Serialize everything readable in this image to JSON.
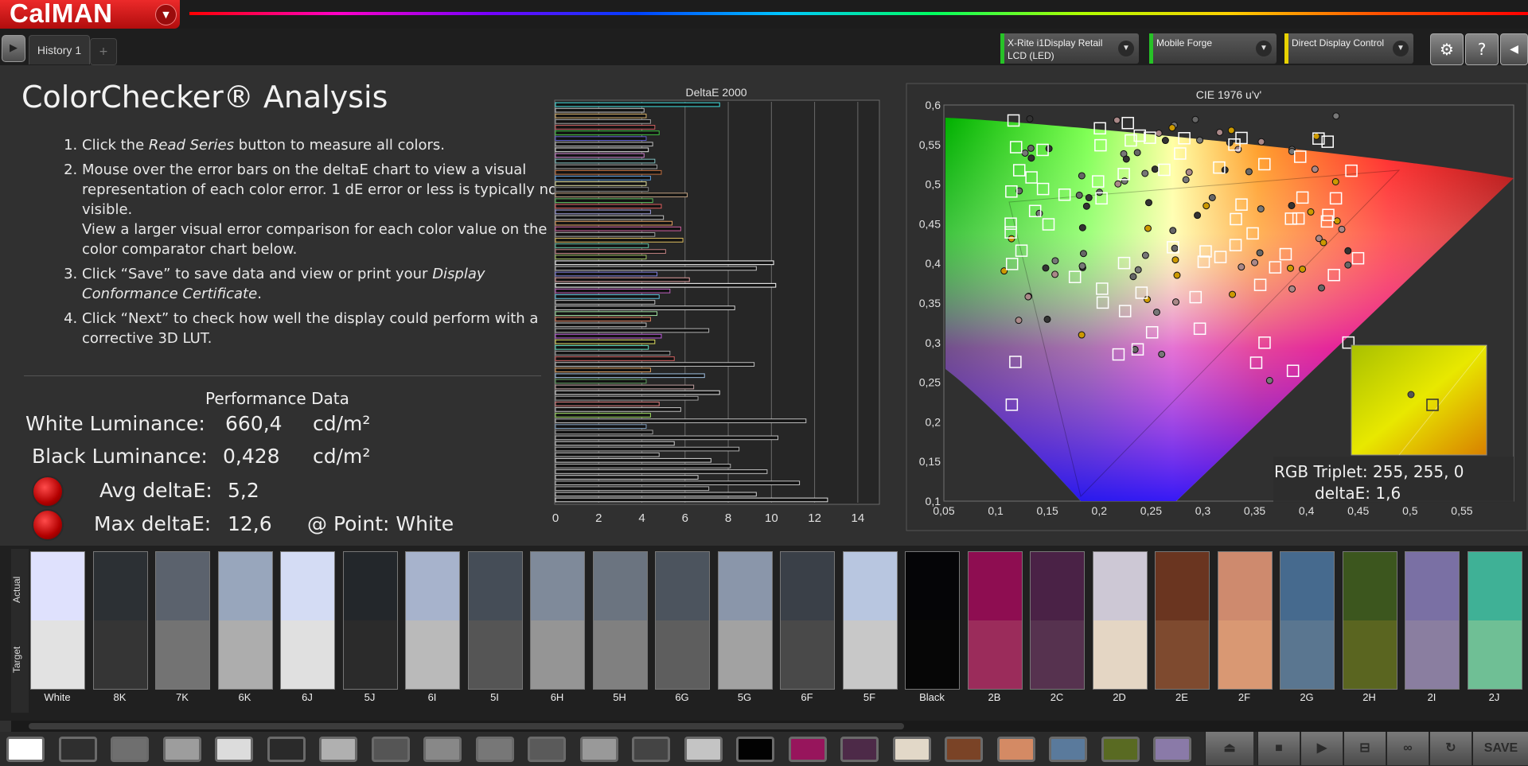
{
  "app": {
    "logo": "CalMAN",
    "menu_arrow": "▼"
  },
  "tabs": [
    {
      "label": "History 1"
    }
  ],
  "tab_add": "+",
  "devices": [
    {
      "line1": "X-Rite i1Display Retail",
      "line2": "LCD (LED)",
      "stripe": "#27c227"
    },
    {
      "line1": "Mobile Forge",
      "line2": "",
      "stripe": "#27c227"
    },
    {
      "line1": "Direct Display Control",
      "line2": "",
      "stripe": "#e8d200"
    }
  ],
  "toolbar_icons": [
    "gear-icon",
    "help-icon",
    "collapse-icon"
  ],
  "page": {
    "title": "ColorChecker® Analysis",
    "instructions": [
      {
        "before": "Click the ",
        "em": "Read Series",
        "after": " button to measure all colors."
      },
      {
        "before": "Mouse over the error bars on the deltaE chart to view a visual representation of each color error. 1 dE error or less is typically not visible.",
        "extra": "View a larger visual error comparison for each color value on the color comparator chart below."
      },
      {
        "before": "Click “Save” to save data and view or print your ",
        "em": "Display Conformance Certificate",
        "after": "."
      },
      {
        "before": "Click “Next” to check how well the display could perform with a corrective 3D LUT."
      }
    ]
  },
  "performance": {
    "title": "Performance Data",
    "white_label": "White Luminance:",
    "white_value": "660,4",
    "white_unit": "cd/m²",
    "black_label": "Black Luminance:",
    "black_value": "0,428",
    "black_unit": "cd/m²",
    "avg_label": "Avg deltaE:",
    "avg_value": "5,2",
    "max_label": "Max deltaE:",
    "max_value": "12,6",
    "point_label": "@ Point: White"
  },
  "cie": {
    "title": "CIE 1976 u'v'",
    "x_ticks": [
      "0,05",
      "0,1",
      "0,15",
      "0,2",
      "0,25",
      "0,3",
      "0,35",
      "0,4",
      "0,45",
      "0,5",
      "0,55"
    ],
    "y_ticks": [
      "0,6",
      "0,55",
      "0,5",
      "0,45",
      "0,4",
      "0,35",
      "0,3",
      "0,25",
      "0,2",
      "0,15",
      "0,1"
    ],
    "tooltip_triplet": "RGB Triplet: 255, 255, 0",
    "tooltip_de": "deltaE: 1,6"
  },
  "chart_data": {
    "type": "bar",
    "title": "DeltaE 2000",
    "orientation": "horizontal",
    "xlim": [
      0,
      15
    ],
    "x_ticks": [
      "0",
      "2",
      "4",
      "6",
      "8",
      "10",
      "12",
      "14"
    ],
    "values": [
      7.6,
      4.1,
      4.2,
      4.4,
      4.6,
      4.8,
      4.2,
      4.5,
      4.3,
      4.1,
      4.6,
      4.7,
      4.9,
      4.4,
      4.2,
      4.3,
      6.1,
      4.5,
      4.9,
      4.4,
      5.0,
      5.4,
      5.8,
      4.6,
      5.9,
      4.3,
      5.1,
      4.2,
      10.1,
      9.3,
      4.7,
      6.2,
      10.2,
      5.3,
      4.8,
      4.6,
      8.3,
      4.7,
      4.4,
      4.2,
      7.1,
      4.9,
      4.6,
      4.3,
      5.3,
      5.5,
      9.2,
      4.4,
      6.9,
      4.2,
      6.4,
      7.6,
      6.6,
      4.8,
      5.8,
      4.4,
      11.6,
      4.2,
      4.5,
      10.3,
      5.5,
      8.5,
      4.8,
      7.2,
      8.1,
      9.8,
      6.6,
      11.3,
      7.1,
      9.3,
      12.6
    ],
    "bar_colors": [
      "#40e0e0",
      "#c0c0c0",
      "#d9b26a",
      "#a0a0a0",
      "#d06060",
      "#40c040",
      "#6060d0",
      "#c0c0c0",
      "#e0e0e0",
      "#d080d0",
      "#80c0c0",
      "#a0a0a0",
      "#c07040",
      "#60a0e0",
      "#e0e0a0",
      "#808080",
      "#c0a080",
      "#60c060",
      "#e06060",
      "#a0a0e0",
      "#c0c0c0",
      "#e0a060",
      "#d060a0",
      "#a0a0a0",
      "#e0c060",
      "#60c0a0",
      "#c08080",
      "#a0c060",
      "#ffffff",
      "#c0c0c0",
      "#8080e0",
      "#e0a0a0",
      "#ffffff",
      "#c060c0",
      "#60c0e0",
      "#c0c0c0",
      "#d0d0d0",
      "#a0e0a0",
      "#e08060",
      "#c0c0c0",
      "#b0b0b0",
      "#c060e0",
      "#e0e060",
      "#60e0c0",
      "#a0a0a0",
      "#d06060",
      "#c0c0c0",
      "#e0a060",
      "#a0c0e0",
      "#60a060",
      "#c0a0a0",
      "#e0e0e0",
      "#a0a0a0",
      "#e08080",
      "#c0c0c0",
      "#a0e060",
      "#c0c0c0",
      "#80a0c0",
      "#a0a0a0",
      "#c0c0c0",
      "#d0d0d0",
      "#b0b0b0",
      "#c0c0c0",
      "#d0d0d0",
      "#b0b0b0",
      "#c0c0c0",
      "#d0d0d0",
      "#c0c0c0",
      "#b0b0b0",
      "#d0d0d0",
      "#e0e0e0"
    ]
  },
  "swatches": [
    {
      "name": "White",
      "actual": "#dfe1fd",
      "target": "#e2e2e2"
    },
    {
      "name": "8K",
      "actual": "#2c3034",
      "target": "#353535"
    },
    {
      "name": "7K",
      "actual": "#5b626d",
      "target": "#737373"
    },
    {
      "name": "6K",
      "actual": "#98a6bc",
      "target": "#adadad"
    },
    {
      "name": "6J",
      "actual": "#d4dcf4",
      "target": "#e0e0e0"
    },
    {
      "name": "5J",
      "actual": "#23272b",
      "target": "#2b2b2b"
    },
    {
      "name": "6I",
      "actual": "#a7b3cc",
      "target": "#bababa"
    },
    {
      "name": "5I",
      "actual": "#454d57",
      "target": "#555555"
    },
    {
      "name": "6H",
      "actual": "#7f8a9a",
      "target": "#959595"
    },
    {
      "name": "5H",
      "actual": "#6b7480",
      "target": "#808080"
    },
    {
      "name": "6G",
      "actual": "#4c545e",
      "target": "#5e5e5e"
    },
    {
      "name": "5G",
      "actual": "#8a96aa",
      "target": "#a2a2a2"
    },
    {
      "name": "6F",
      "actual": "#3a4048",
      "target": "#494949"
    },
    {
      "name": "5F",
      "actual": "#b8c6e0",
      "target": "#c8c8c8"
    },
    {
      "name": "Black",
      "actual": "#050507",
      "target": "#060606"
    },
    {
      "name": "2B",
      "actual": "#8e0d51",
      "target": "#9b2c5b"
    },
    {
      "name": "2C",
      "actual": "#4a2246",
      "target": "#56324f"
    },
    {
      "name": "2D",
      "actual": "#cdc8d5",
      "target": "#e4d6c4"
    },
    {
      "name": "2E",
      "actual": "#6a3520",
      "target": "#7e4a2f"
    },
    {
      "name": "2F",
      "actual": "#ce8a6e",
      "target": "#d99873"
    },
    {
      "name": "2G",
      "actual": "#466a8e",
      "target": "#5a7690"
    },
    {
      "name": "2H",
      "actual": "#3c561e",
      "target": "#5a6520"
    },
    {
      "name": "2I",
      "actual": "#7a70a4",
      "target": "#8a7ea0"
    },
    {
      "name": "2J",
      "actual": "#3fb196",
      "target": "#6fbf95"
    }
  ],
  "swatch_row_labels": {
    "actual": "Actual",
    "target": "Target"
  },
  "bottom_chips": [
    "#ffffff",
    "#2f2f2f",
    "#6f6f6f",
    "#9d9d9d",
    "#dcdcdc",
    "#2a2a2a",
    "#b0b0b0",
    "#555555",
    "#888888",
    "#777777",
    "#5a5a5a",
    "#999999",
    "#444444",
    "#c4c4c4",
    "#020202",
    "#97155c",
    "#4d2a48",
    "#e2d8c8",
    "#7a4326",
    "#d48a64",
    "#5a7a9c",
    "#596a22",
    "#8a7aa8"
  ],
  "bottom_controls": {
    "save": "SAVE"
  }
}
